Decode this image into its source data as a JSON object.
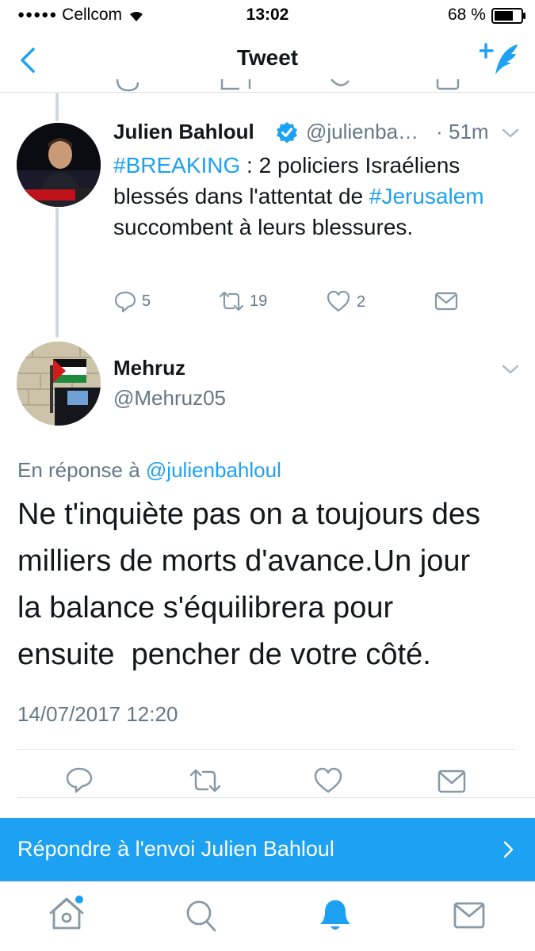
{
  "status_bar": {
    "carrier": "Cellcom",
    "time": "13:02",
    "battery_percent": "68 %"
  },
  "nav": {
    "title": "Tweet",
    "back_icon": "chevron-left-icon",
    "compose_icon": "compose-tweet-icon"
  },
  "parent_tweet": {
    "author_name": "Julien Bahloul",
    "verified": true,
    "handle_truncated": "@julienba…",
    "separator": "·",
    "age": "51m",
    "text_parts": [
      {
        "text": "#BREAKING",
        "link": true
      },
      {
        "text": " : 2 policiers Israéliens blessés dans l'attentat de ",
        "link": false
      },
      {
        "text": "#Jerusalem",
        "link": true
      },
      {
        "text": " succombent à leurs blessures.",
        "link": false
      }
    ],
    "stats": {
      "replies": "5",
      "retweets": "19",
      "likes": "2"
    }
  },
  "reply_tweet": {
    "author_name": "Mehruz",
    "handle": "@Mehruz05",
    "reply_prefix": "En réponse à",
    "reply_to_handle": "@julienbahloul",
    "text_lines": [
      "Ne t'inquiète pas on a toujours des",
      "milliers de morts d'avance.Un jour",
      "la balance s'équilibrera pour",
      "ensuite  pencher de votre côté."
    ],
    "timestamp": "14/07/2017 12:20"
  },
  "reply_bar": {
    "label": "Répondre à l'envoi Julien Bahloul"
  },
  "colors": {
    "accent": "#1da1f2",
    "secondary_text": "#657786",
    "icon_gray": "#8899a6"
  }
}
